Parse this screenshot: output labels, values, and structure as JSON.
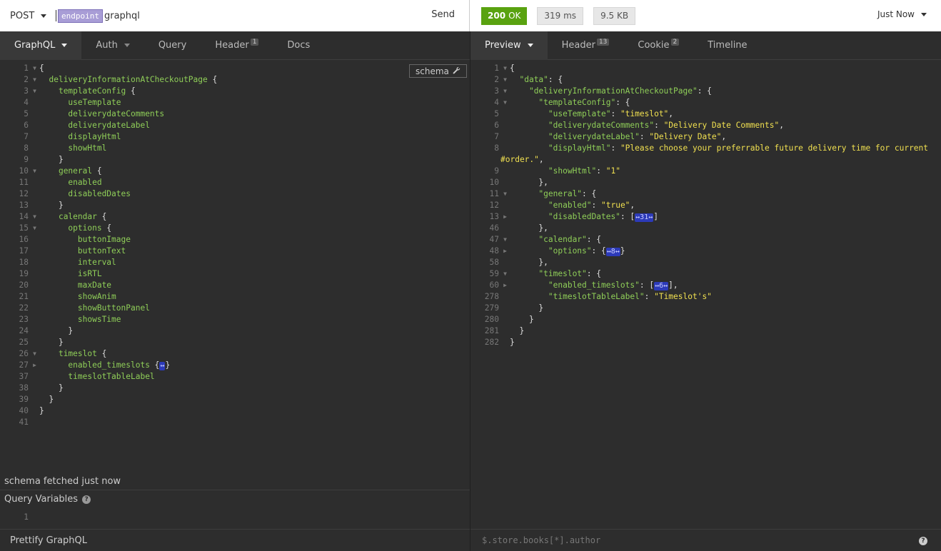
{
  "request": {
    "method": "POST",
    "env_tag": "endpoint",
    "url_path": "graphql",
    "send_label": "Send"
  },
  "response_meta": {
    "status_code": "200",
    "status_text": "OK",
    "time": "319 ms",
    "size": "9.5 KB",
    "history_label": "Just Now"
  },
  "left_tabs": [
    {
      "label": "GraphQL",
      "badge": ""
    },
    {
      "label": "Auth",
      "badge": ""
    },
    {
      "label": "Query",
      "badge": ""
    },
    {
      "label": "Header",
      "badge": "1"
    },
    {
      "label": "Docs",
      "badge": ""
    }
  ],
  "right_tabs": [
    {
      "label": "Preview",
      "badge": ""
    },
    {
      "label": "Header",
      "badge": "13"
    },
    {
      "label": "Cookie",
      "badge": "2"
    },
    {
      "label": "Timeline",
      "badge": ""
    }
  ],
  "schema_button": "schema",
  "query_lines": [
    {
      "n": "1",
      "fold": "▼",
      "indent": 0,
      "text": "{"
    },
    {
      "n": "2",
      "fold": "▼",
      "indent": 1,
      "text": "deliveryInformationAtCheckoutPage {"
    },
    {
      "n": "3",
      "fold": "▼",
      "indent": 2,
      "text": "templateConfig {"
    },
    {
      "n": "4",
      "fold": "",
      "indent": 3,
      "text": "useTemplate"
    },
    {
      "n": "5",
      "fold": "",
      "indent": 3,
      "text": "deliverydateComments"
    },
    {
      "n": "6",
      "fold": "",
      "indent": 3,
      "text": "deliverydateLabel"
    },
    {
      "n": "7",
      "fold": "",
      "indent": 3,
      "text": "displayHtml"
    },
    {
      "n": "8",
      "fold": "",
      "indent": 3,
      "text": "showHtml"
    },
    {
      "n": "9",
      "fold": "",
      "indent": 2,
      "text": "}"
    },
    {
      "n": "10",
      "fold": "▼",
      "indent": 2,
      "text": "general {"
    },
    {
      "n": "11",
      "fold": "",
      "indent": 3,
      "text": "enabled"
    },
    {
      "n": "12",
      "fold": "",
      "indent": 3,
      "text": "disabledDates"
    },
    {
      "n": "13",
      "fold": "",
      "indent": 2,
      "text": "}"
    },
    {
      "n": "14",
      "fold": "▼",
      "indent": 2,
      "text": "calendar {"
    },
    {
      "n": "15",
      "fold": "▼",
      "indent": 3,
      "text": "options {"
    },
    {
      "n": "16",
      "fold": "",
      "indent": 4,
      "text": "buttonImage"
    },
    {
      "n": "17",
      "fold": "",
      "indent": 4,
      "text": "buttonText"
    },
    {
      "n": "18",
      "fold": "",
      "indent": 4,
      "text": "interval"
    },
    {
      "n": "19",
      "fold": "",
      "indent": 4,
      "text": "isRTL"
    },
    {
      "n": "20",
      "fold": "",
      "indent": 4,
      "text": "maxDate"
    },
    {
      "n": "21",
      "fold": "",
      "indent": 4,
      "text": "showAnim"
    },
    {
      "n": "22",
      "fold": "",
      "indent": 4,
      "text": "showButtonPanel"
    },
    {
      "n": "23",
      "fold": "",
      "indent": 4,
      "text": "showsTime"
    },
    {
      "n": "24",
      "fold": "",
      "indent": 3,
      "text": "}"
    },
    {
      "n": "25",
      "fold": "",
      "indent": 2,
      "text": "}"
    },
    {
      "n": "26",
      "fold": "▼",
      "indent": 2,
      "text": "timeslot {"
    },
    {
      "n": "27",
      "fold": "▶",
      "indent": 3,
      "text": "enabled_timeslots {",
      "pill": "↔",
      "after": "}"
    },
    {
      "n": "37",
      "fold": "",
      "indent": 3,
      "text": "timeslotTableLabel"
    },
    {
      "n": "38",
      "fold": "",
      "indent": 2,
      "text": "}"
    },
    {
      "n": "39",
      "fold": "",
      "indent": 1,
      "text": "}"
    },
    {
      "n": "40",
      "fold": "",
      "indent": 0,
      "text": "}"
    },
    {
      "n": "41",
      "fold": "",
      "indent": 0,
      "text": ""
    }
  ],
  "response_lines": [
    {
      "n": "1",
      "fold": "▼",
      "indent": 0,
      "parts": [
        [
          "p",
          "{"
        ]
      ]
    },
    {
      "n": "2",
      "fold": "▼",
      "indent": 1,
      "parts": [
        [
          "k",
          "\"data\""
        ],
        [
          "p",
          ": {"
        ]
      ]
    },
    {
      "n": "3",
      "fold": "▼",
      "indent": 2,
      "parts": [
        [
          "k",
          "\"deliveryInformationAtCheckoutPage\""
        ],
        [
          "p",
          ": {"
        ]
      ]
    },
    {
      "n": "4",
      "fold": "▼",
      "indent": 3,
      "parts": [
        [
          "k",
          "\"templateConfig\""
        ],
        [
          "p",
          ": {"
        ]
      ]
    },
    {
      "n": "5",
      "fold": "",
      "indent": 4,
      "parts": [
        [
          "k",
          "\"useTemplate\""
        ],
        [
          "p",
          ": "
        ],
        [
          "s",
          "\"timeslot\""
        ],
        [
          "p",
          ","
        ]
      ]
    },
    {
      "n": "6",
      "fold": "",
      "indent": 4,
      "parts": [
        [
          "k",
          "\"deliverydateComments\""
        ],
        [
          "p",
          ": "
        ],
        [
          "s",
          "\"Delivery Date Comments\""
        ],
        [
          "p",
          ","
        ]
      ]
    },
    {
      "n": "7",
      "fold": "",
      "indent": 4,
      "parts": [
        [
          "k",
          "\"deliverydateLabel\""
        ],
        [
          "p",
          ": "
        ],
        [
          "s",
          "\"Delivery Date\""
        ],
        [
          "p",
          ","
        ]
      ]
    },
    {
      "n": "8",
      "fold": "",
      "indent": 4,
      "parts": [
        [
          "k",
          "\"displayHtml\""
        ],
        [
          "p",
          ": "
        ],
        [
          "s",
          "\"Please choose your preferrable future delivery time for current"
        ]
      ]
    },
    {
      "n": "",
      "fold": "",
      "indent": 0,
      "wrap": true,
      "parts": [
        [
          "s",
          "#order.\""
        ],
        [
          "p",
          ","
        ]
      ]
    },
    {
      "n": "9",
      "fold": "",
      "indent": 4,
      "parts": [
        [
          "k",
          "\"showHtml\""
        ],
        [
          "p",
          ": "
        ],
        [
          "s",
          "\"1\""
        ]
      ]
    },
    {
      "n": "10",
      "fold": "",
      "indent": 3,
      "parts": [
        [
          "p",
          "},"
        ]
      ]
    },
    {
      "n": "11",
      "fold": "▼",
      "indent": 3,
      "parts": [
        [
          "k",
          "\"general\""
        ],
        [
          "p",
          ": {"
        ]
      ]
    },
    {
      "n": "12",
      "fold": "",
      "indent": 4,
      "parts": [
        [
          "k",
          "\"enabled\""
        ],
        [
          "p",
          ": "
        ],
        [
          "s",
          "\"true\""
        ],
        [
          "p",
          ","
        ]
      ]
    },
    {
      "n": "13",
      "fold": "▶",
      "indent": 4,
      "parts": [
        [
          "k",
          "\"disabledDates\""
        ],
        [
          "p",
          ": ["
        ],
        [
          "f",
          "↔31↔"
        ],
        [
          "p",
          "]"
        ]
      ]
    },
    {
      "n": "46",
      "fold": "",
      "indent": 3,
      "parts": [
        [
          "p",
          "},"
        ]
      ]
    },
    {
      "n": "47",
      "fold": "▼",
      "indent": 3,
      "parts": [
        [
          "k",
          "\"calendar\""
        ],
        [
          "p",
          ": {"
        ]
      ]
    },
    {
      "n": "48",
      "fold": "▶",
      "indent": 4,
      "parts": [
        [
          "k",
          "\"options\""
        ],
        [
          "p",
          ": {"
        ],
        [
          "f",
          "↔8↔"
        ],
        [
          "p",
          "}"
        ]
      ]
    },
    {
      "n": "58",
      "fold": "",
      "indent": 3,
      "parts": [
        [
          "p",
          "},"
        ]
      ]
    },
    {
      "n": "59",
      "fold": "▼",
      "indent": 3,
      "parts": [
        [
          "k",
          "\"timeslot\""
        ],
        [
          "p",
          ": {"
        ]
      ]
    },
    {
      "n": "60",
      "fold": "▶",
      "indent": 4,
      "parts": [
        [
          "k",
          "\"enabled_timeslots\""
        ],
        [
          "p",
          ": ["
        ],
        [
          "f",
          "↔6↔"
        ],
        [
          "p",
          "],"
        ]
      ]
    },
    {
      "n": "278",
      "fold": "",
      "indent": 4,
      "parts": [
        [
          "k",
          "\"timeslotTableLabel\""
        ],
        [
          "p",
          ": "
        ],
        [
          "s",
          "\"Timeslot's\""
        ]
      ]
    },
    {
      "n": "279",
      "fold": "",
      "indent": 3,
      "parts": [
        [
          "p",
          "}"
        ]
      ]
    },
    {
      "n": "280",
      "fold": "",
      "indent": 2,
      "parts": [
        [
          "p",
          "}"
        ]
      ]
    },
    {
      "n": "281",
      "fold": "",
      "indent": 1,
      "parts": [
        [
          "p",
          "}"
        ]
      ]
    },
    {
      "n": "282",
      "fold": "",
      "indent": 0,
      "parts": [
        [
          "p",
          "}"
        ]
      ]
    }
  ],
  "schema_status": "schema fetched just now",
  "query_variables": {
    "title": "Query Variables",
    "line_number": "1"
  },
  "footer": {
    "prettify_label": "Prettify GraphQL",
    "filter_placeholder": "$.store.books[*].author"
  },
  "colors": {
    "ok_green": "#59a210",
    "env_purple": "#a89dd6",
    "key_green": "#8fce58",
    "string_yellow": "#f0e050",
    "fold_blue": "#2c3ab8"
  }
}
